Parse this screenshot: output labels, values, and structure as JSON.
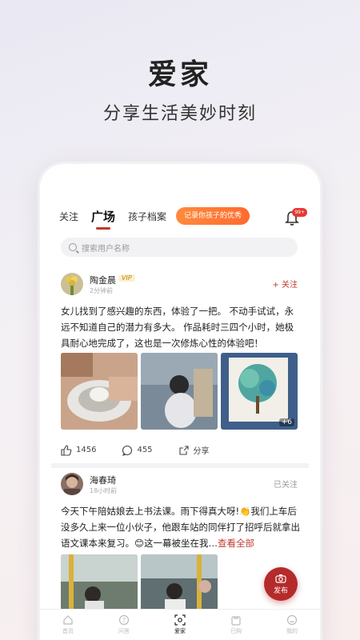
{
  "hero": {
    "title": "爱家",
    "subtitle": "分享生活美妙时刻"
  },
  "topnav": {
    "tabs": [
      "关注",
      "广场",
      "孩子档案"
    ],
    "badge": "记录你孩子的优秀",
    "bell_count": "99+"
  },
  "search": {
    "placeholder": "搜索用户名称"
  },
  "posts": [
    {
      "user": "陶金晨",
      "vip": "VIP",
      "time": "2分钟前",
      "follow": "+ 关注",
      "text": "女儿找到了感兴趣的东西，体验了一把。 不动手试试，永远不知道自己的潜力有多大。 作品耗时三四个小时，她极具耐心地完成了，这也是一次修炼心性的体验吧！",
      "more_images": "+6",
      "likes": "1456",
      "comments": "455",
      "share": "分享"
    },
    {
      "user": "海春琦",
      "time": "18小时前",
      "follow": "已关注",
      "text": "今天下午陪姑娘去上书法课。雨下得真大呀!👏我们上车后没多久上来一位小伙子，他跟车站的同伴打了招呼后就拿出语文课本来复习。😊这一幕被坐在我…",
      "more": "查看全部"
    }
  ],
  "fab": {
    "label": "发布"
  },
  "bottombar": [
    "首页",
    "问答",
    "爱家",
    "已购",
    "我的"
  ],
  "colors": {
    "accent": "#c0392b",
    "badge_orange": "#ff7a35"
  }
}
